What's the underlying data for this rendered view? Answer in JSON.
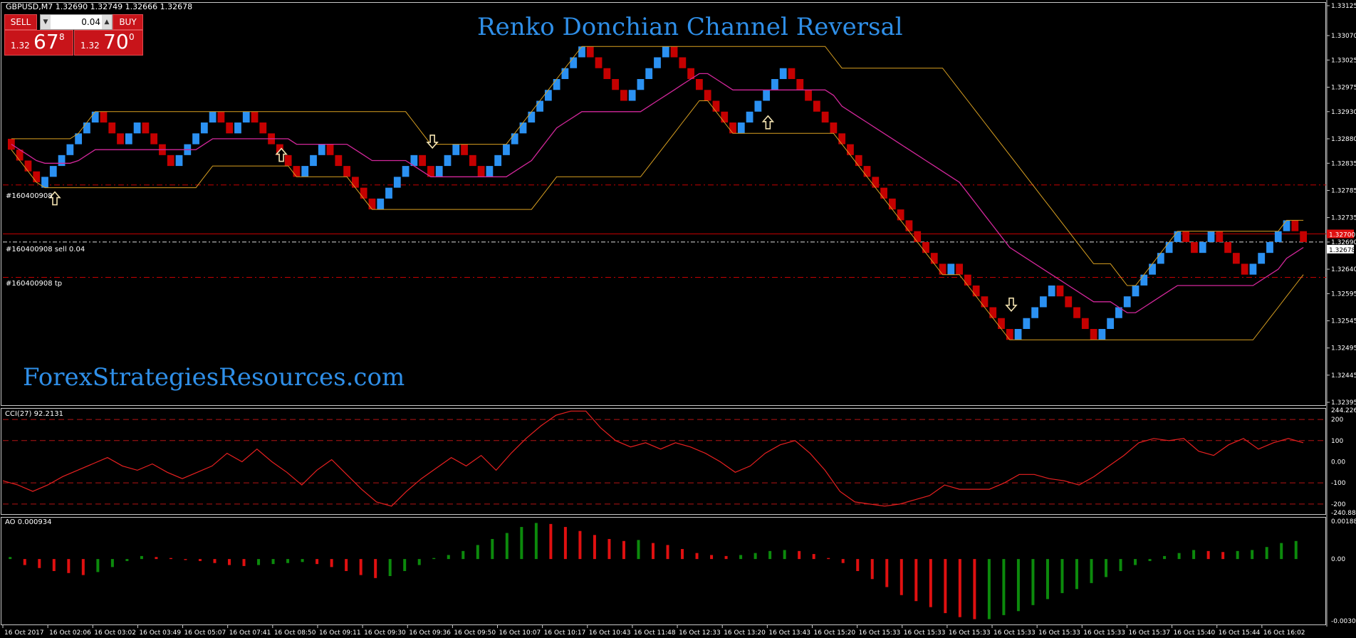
{
  "symbol_info": "GBPUSD,M7  1.32690 1.32749 1.32666 1.32678",
  "title": "Renko Donchian Channel Reversal",
  "watermark": "ForexStrategiesResources.com",
  "trade_panel": {
    "sell_label": "SELL",
    "buy_label": "BUY",
    "lot_size": "0.04",
    "sell_price": {
      "prefix": "1.32",
      "big": "67",
      "sup": "8"
    },
    "buy_price": {
      "prefix": "1.32",
      "big": "70",
      "sup": "0"
    }
  },
  "order_labels": {
    "order1": "#160400908",
    "sell": "#160400908 sell 0.04",
    "tp": "#160400908 tp"
  },
  "colors": {
    "bull_brick": "#2b91f2",
    "bear_brick": "#c50000",
    "upper_channel": "#d9a021",
    "mid_channel": "#d2279a",
    "cci_line": "#e82020",
    "ao_up": "#0c8a0c",
    "ao_down": "#e01010",
    "title": "#2f8fe8"
  },
  "chart_data": [
    {
      "type": "renko",
      "name": "GBPUSD,M7",
      "y_axis": {
        "range": [
          1.32395,
          1.33125
        ],
        "ticks": [
          "1.33125",
          "1.33070",
          "1.33025",
          "1.32975",
          "1.32930",
          "1.32880",
          "1.32835",
          "1.32785",
          "1.32735",
          "1.32690",
          "1.32640",
          "1.32595",
          "1.32545",
          "1.32495",
          "1.32445",
          "1.32395"
        ]
      },
      "current_price": "1.32678",
      "price_tag": "1.32700",
      "bricks_open": [
        1.3288,
        1.3286,
        1.3284,
        1.3282,
        1.3279,
        1.3281,
        1.3283,
        1.3285,
        1.3287,
        1.3289,
        1.3291,
        1.3293,
        1.3291,
        1.3289,
        1.3287,
        1.3289,
        1.3291,
        1.3289,
        1.3287,
        1.3285,
        1.3283,
        1.3285,
        1.3287,
        1.3289,
        1.3291,
        1.3293,
        1.3291,
        1.3289,
        1.3291,
        1.3293,
        1.3291,
        1.3289,
        1.3287,
        1.3285,
        1.3283,
        1.3281,
        1.3283,
        1.3285,
        1.3287,
        1.3285,
        1.3283,
        1.3281,
        1.3279,
        1.3277,
        1.3275,
        1.3277,
        1.3279,
        1.3281,
        1.3283,
        1.3285,
        1.3283,
        1.3281,
        1.3283,
        1.3285,
        1.3287,
        1.3285,
        1.3283,
        1.3281,
        1.3283,
        1.3285,
        1.3287,
        1.3289,
        1.3291,
        1.3293,
        1.3295,
        1.3297,
        1.3299,
        1.3301,
        1.3303,
        1.3305,
        1.3303,
        1.3301,
        1.3299,
        1.3297,
        1.3295,
        1.3297,
        1.3299,
        1.3301,
        1.3303,
        1.3305,
        1.3303,
        1.3301,
        1.3299,
        1.3297,
        1.3295,
        1.3293,
        1.3291,
        1.3289,
        1.3291,
        1.3293,
        1.3295,
        1.3297,
        1.3299,
        1.3301,
        1.3299,
        1.3297,
        1.3295,
        1.3293,
        1.3291,
        1.3289,
        1.3287,
        1.3285,
        1.3283,
        1.3281,
        1.3279,
        1.3277,
        1.3275,
        1.3273,
        1.3271,
        1.3269,
        1.3267,
        1.3265,
        1.3263,
        1.3265,
        1.3263,
        1.3261,
        1.3259,
        1.3257,
        1.3255,
        1.3253,
        1.3251,
        1.3253,
        1.3255,
        1.3257,
        1.3259,
        1.3261,
        1.3259,
        1.3257,
        1.3255,
        1.3253,
        1.3251,
        1.3253,
        1.3255,
        1.3257,
        1.3259,
        1.3261,
        1.3263,
        1.3265,
        1.3267,
        1.3269,
        1.3271,
        1.3269,
        1.3267,
        1.3269,
        1.3271,
        1.3269,
        1.3267,
        1.3265,
        1.3263,
        1.3265,
        1.3267,
        1.3269,
        1.3271,
        1.3273,
        1.3271
      ],
      "brick_size": 0.0002,
      "signals": [
        {
          "type": "buy",
          "brick": 4
        },
        {
          "type": "buy",
          "brick": 31
        },
        {
          "type": "sell",
          "brick": 49
        },
        {
          "type": "buy",
          "brick": 89
        },
        {
          "type": "sell",
          "brick": 118
        }
      ],
      "levels": {
        "order1": 1.32795,
        "sell": 1.32705,
        "bid": 1.3269,
        "tp": 1.32625
      }
    },
    {
      "type": "line",
      "name": "CCI(27) 92.2131",
      "y_axis": {
        "range": [
          -240.8803,
          244.226
        ],
        "ticks": [
          "244.226",
          "200",
          "100",
          "0.00",
          "-100",
          "-200",
          "-240.8803"
        ]
      },
      "levels": [
        200,
        100,
        -100,
        -200
      ],
      "values": [
        -90,
        -110,
        -140,
        -110,
        -70,
        -40,
        -10,
        20,
        -20,
        -40,
        -10,
        -50,
        -80,
        -50,
        -20,
        40,
        0,
        60,
        0,
        -50,
        -110,
        -40,
        10,
        -60,
        -130,
        -190,
        -210,
        -140,
        -80,
        -30,
        20,
        -20,
        30,
        -40,
        40,
        110,
        170,
        220,
        240,
        240,
        160,
        100,
        70,
        90,
        60,
        90,
        70,
        40,
        0,
        -50,
        -20,
        40,
        80,
        100,
        40,
        -40,
        -140,
        -190,
        -200,
        -210,
        -200,
        -180,
        -160,
        -110,
        -130,
        -130,
        -130,
        -100,
        -60,
        -60,
        -80,
        -90,
        -110,
        -70,
        -20,
        30,
        90,
        110,
        100,
        110,
        50,
        30,
        80,
        110,
        60,
        90,
        110,
        90
      ]
    },
    {
      "type": "bar",
      "name": "AO 0.000934",
      "y_axis": {
        "range": [
          -0.003088,
          0.001887
        ],
        "ticks": [
          "0.001887",
          "0.00",
          "-0.003088"
        ]
      },
      "values": [
        0.0001,
        -0.0003,
        -0.00045,
        -0.0006,
        -0.0007,
        -0.0008,
        -0.00065,
        -0.0004,
        -0.0001,
        0.00015,
        0.0001,
        5e-05,
        -5e-05,
        -0.0001,
        -0.0002,
        -0.0003,
        -0.00035,
        -0.0003,
        -0.00025,
        -0.0002,
        -0.00015,
        -0.00025,
        -0.0004,
        -0.0006,
        -0.0008,
        -0.00095,
        -0.00085,
        -0.0006,
        -0.0003,
        5e-05,
        0.0002,
        0.0004,
        0.0007,
        0.001,
        0.0013,
        0.0016,
        0.0018,
        0.00175,
        0.0016,
        0.0014,
        0.0012,
        0.001,
        0.0009,
        0.00095,
        0.0008,
        0.0007,
        0.0005,
        0.0003,
        0.0002,
        0.00015,
        0.0002,
        0.0003,
        0.0004,
        0.00045,
        0.0004,
        0.00025,
        5e-05,
        -0.0002,
        -0.0006,
        -0.001,
        -0.0014,
        -0.0018,
        -0.0021,
        -0.0024,
        -0.0027,
        -0.0029,
        -0.003,
        -0.003,
        -0.0028,
        -0.0026,
        -0.0023,
        -0.002,
        -0.0017,
        -0.0015,
        -0.0012,
        -0.0009,
        -0.0006,
        -0.0003,
        -0.0001,
        0.00015,
        0.0003,
        0.00045,
        0.0004,
        0.00035,
        0.0004,
        0.00045,
        0.0006,
        0.0008,
        0.0009
      ]
    }
  ],
  "time_axis": [
    "16 Oct 2017",
    "16 Oct 02:06",
    "16 Oct 03:02",
    "16 Oct 03:49",
    "16 Oct 05:07",
    "16 Oct 07:41",
    "16 Oct 08:50",
    "16 Oct 09:11",
    "16 Oct 09:30",
    "16 Oct 09:36",
    "16 Oct 09:50",
    "16 Oct 10:07",
    "16 Oct 10:17",
    "16 Oct 10:43",
    "16 Oct 11:48",
    "16 Oct 12:33",
    "16 Oct 13:20",
    "16 Oct 13:43",
    "16 Oct 15:20",
    "16 Oct 15:33",
    "16 Oct 15:33",
    "16 Oct 15:33",
    "16 Oct 15:33",
    "16 Oct 15:33",
    "16 Oct 15:33",
    "16 Oct 15:37",
    "16 Oct 15:40",
    "16 Oct 15:44",
    "16 Oct 16:02"
  ]
}
